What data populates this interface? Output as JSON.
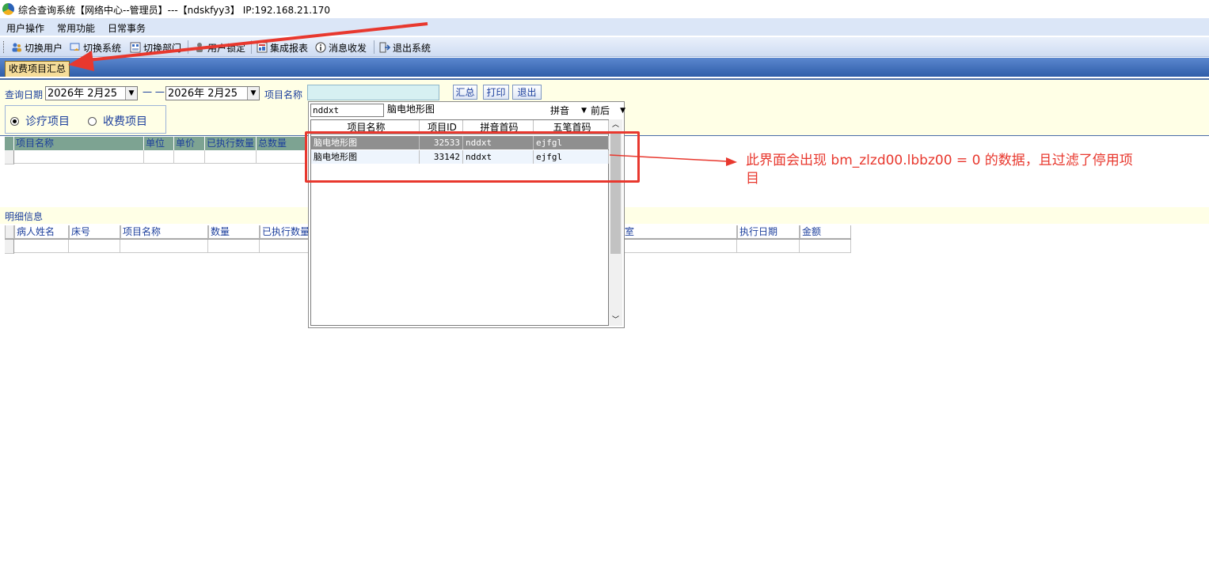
{
  "window": {
    "title": "综合查询系统【网络中心--管理员】---【ndskfyy3】 IP:192.168.21.170"
  },
  "menu": [
    "用户操作",
    "常用功能",
    "日常事务"
  ],
  "toolbar": {
    "items": [
      {
        "label": "切换用户",
        "icon": "users-icon"
      },
      {
        "label": "切换系统",
        "icon": "switch-system-icon"
      },
      {
        "label": "切换部门",
        "icon": "department-icon"
      },
      {
        "label": "用户锁定",
        "icon": "lock-user-icon"
      },
      {
        "label": "集成报表",
        "icon": "report-icon"
      },
      {
        "label": "消息收发",
        "icon": "info-icon"
      },
      {
        "label": "退出系统",
        "icon": "exit-icon"
      }
    ]
  },
  "tabs": [
    {
      "label": "收费项目汇总",
      "active": true
    }
  ],
  "filter": {
    "date_label": "查询日期",
    "date_from": "2026年  2月25",
    "separator": "一 一",
    "date_to": "2026年  2月25",
    "item_label": "项目名称",
    "item_value": "",
    "buttons": {
      "summary": "汇总",
      "print": "打印",
      "exit": "退出"
    },
    "radios": [
      {
        "label": "诊疗项目",
        "checked": true
      },
      {
        "label": "收费项目",
        "checked": false
      }
    ]
  },
  "summary_grid": {
    "columns": [
      "项目名称",
      "单位",
      "单价",
      "已执行数量",
      "总数量"
    ]
  },
  "detail": {
    "section_label": "明细信息",
    "columns_left": [
      "病人姓名",
      "床号",
      "项目名称",
      "数量",
      "已执行数量"
    ],
    "columns_right": [
      "室",
      "执行日期",
      "金额"
    ]
  },
  "lookup_popup": {
    "search_input": "nddxt",
    "search_result_name": "脑电地形图",
    "mode_select": "拼音",
    "match_select": "前后",
    "columns": [
      "项目名称",
      "项目ID",
      "拼音首码",
      "五笔首码"
    ],
    "rows": [
      {
        "name": "脑电地形图",
        "id": "32533",
        "pinyin": "nddxt",
        "wubi": "ejfgl",
        "selected": true
      },
      {
        "name": "脑电地形图",
        "id": "33142",
        "pinyin": "nddxt",
        "wubi": "ejfgl",
        "selected": false
      }
    ]
  },
  "annotation": {
    "text": "此界面会出现  bm_zlzd00.lbbz00 = 0 的数据，且过滤了停用项目",
    "color": "#e8382e"
  }
}
